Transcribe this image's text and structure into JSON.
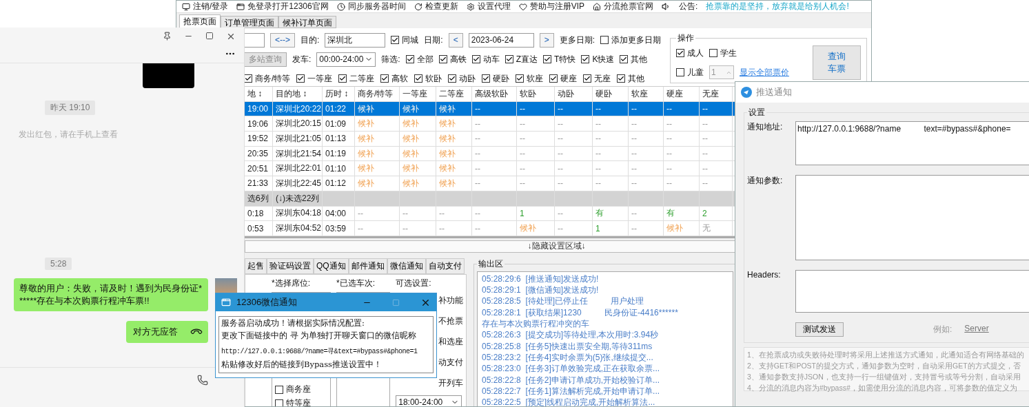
{
  "main_window": {
    "toolbar": [
      {
        "label": "注销/登录"
      },
      {
        "label": "免登录打开12306官网"
      },
      {
        "label": "同步服务器时间"
      },
      {
        "label": "检查更新"
      },
      {
        "label": "设置代理"
      },
      {
        "label": "赞助与注册VIP"
      },
      {
        "label": "分流抢票官网"
      }
    ],
    "announcement": {
      "label": "公告:",
      "text": "抢票靠的是坚持，放弃就是给别人机会!"
    },
    "tabs": [
      {
        "label": "抢票页面",
        "selected": true
      },
      {
        "label": "订单管理页面",
        "selected": false
      },
      {
        "label": "候补订单页面",
        "selected": false
      }
    ],
    "query": {
      "swap_button": "<-->",
      "to_label": "目的:",
      "to_value": "深圳北",
      "same_city": {
        "label": "同城",
        "checked": true
      },
      "date_label": "日期:",
      "prev_button": "<",
      "date_value": "2023-06-24",
      "next_button": ">",
      "more_dates_label": "更多日期:",
      "add_dates": {
        "label": "添加更多日期",
        "checked": false
      },
      "multi_station_button": "多站查询",
      "depart_label": "发车:",
      "depart_value": "00:00-24:00",
      "filter_label": "筛选:",
      "filters": [
        {
          "label": "全部",
          "checked": true
        },
        {
          "label": "高铁",
          "checked": true
        },
        {
          "label": "动车",
          "checked": true
        },
        {
          "label": "Z直达",
          "checked": true
        },
        {
          "label": "T特快",
          "checked": true
        },
        {
          "label": "K快速",
          "checked": true
        },
        {
          "label": "其他",
          "checked": true
        }
      ],
      "seat_filters": [
        {
          "label": "商务/特等",
          "checked": true
        },
        {
          "label": "一等座",
          "checked": true
        },
        {
          "label": "二等座",
          "checked": true
        },
        {
          "label": "高软",
          "checked": true
        },
        {
          "label": "软卧",
          "checked": true
        },
        {
          "label": "动卧",
          "checked": true
        },
        {
          "label": "硬卧",
          "checked": true
        },
        {
          "label": "软座",
          "checked": true
        },
        {
          "label": "硬座",
          "checked": true
        },
        {
          "label": "无座",
          "checked": true
        },
        {
          "label": "其他",
          "checked": true
        }
      ]
    },
    "operations": {
      "title": "操作",
      "adult": {
        "label": "成人",
        "checked": true
      },
      "student": {
        "label": "学生",
        "checked": false
      },
      "child": {
        "label": "儿童",
        "checked": false
      },
      "child_count": "1",
      "show_prices_link": "显示全部票价",
      "query_button": "查询车票"
    },
    "table": {
      "columns": [
        "地 ↕",
        "目的地 ↕",
        "历时 ↕",
        "商务/特等",
        "一等座",
        "二等座",
        "高级软卧",
        "软卧",
        "动卧",
        "硬卧",
        "软座",
        "硬座",
        "无座"
      ],
      "rows": [
        {
          "kind": "train",
          "selected": true,
          "cells": [
            "19:00",
            "深圳北20:22",
            "01:22",
            {
              "text": "候补",
              "kind": "waitlist"
            },
            {
              "text": "候补",
              "kind": "waitlist"
            },
            {
              "text": "候补",
              "kind": "waitlist"
            },
            "--",
            "--",
            "--",
            "--",
            "--",
            "--",
            "--"
          ]
        },
        {
          "kind": "train",
          "selected": false,
          "cells": [
            "19:06",
            "深圳北20:15",
            "01:09",
            {
              "text": "候补",
              "kind": "waitlist"
            },
            {
              "text": "候补",
              "kind": "waitlist"
            },
            {
              "text": "候补",
              "kind": "waitlist"
            },
            "--",
            "--",
            "--",
            "--",
            "--",
            "--",
            "--"
          ]
        },
        {
          "kind": "train",
          "selected": false,
          "cells": [
            "19:52",
            "深圳北21:05",
            "01:13",
            {
              "text": "候补",
              "kind": "waitlist"
            },
            {
              "text": "候补",
              "kind": "waitlist"
            },
            {
              "text": "候补",
              "kind": "waitlist"
            },
            "--",
            "--",
            "--",
            "--",
            "--",
            "--",
            "--"
          ]
        },
        {
          "kind": "train",
          "selected": false,
          "cells": [
            "20:35",
            "深圳北21:54",
            "01:19",
            {
              "text": "候补",
              "kind": "waitlist"
            },
            {
              "text": "候补",
              "kind": "waitlist"
            },
            {
              "text": "候补",
              "kind": "waitlist"
            },
            "--",
            "--",
            "--",
            "--",
            "--",
            "--",
            "--"
          ]
        },
        {
          "kind": "train",
          "selected": false,
          "cells": [
            "20:51",
            "深圳北22:01",
            "01:10",
            {
              "text": "候补",
              "kind": "waitlist"
            },
            {
              "text": "候补",
              "kind": "waitlist"
            },
            {
              "text": "候补",
              "kind": "waitlist"
            },
            "--",
            "--",
            "--",
            "--",
            "--",
            "--",
            "--"
          ]
        },
        {
          "kind": "train",
          "selected": false,
          "cells": [
            "21:33",
            "深圳北22:45",
            "01:12",
            {
              "text": "候补",
              "kind": "waitlist"
            },
            {
              "text": "候补",
              "kind": "waitlist"
            },
            {
              "text": "候补",
              "kind": "waitlist"
            },
            "--",
            "--",
            "--",
            "--",
            "--",
            "--",
            "--"
          ]
        },
        {
          "kind": "group",
          "selected": false,
          "cells": [
            "选6列",
            "(↓)未选22列"
          ]
        },
        {
          "kind": "train",
          "selected": false,
          "cells": [
            "0:18",
            "深圳东04:18",
            "04:00",
            "--",
            "--",
            "--",
            "--",
            {
              "text": "1",
              "kind": "available"
            },
            "--",
            {
              "text": "有",
              "kind": "available"
            },
            "--",
            {
              "text": "有",
              "kind": "available"
            },
            {
              "text": "2",
              "kind": "available"
            }
          ]
        },
        {
          "kind": "train",
          "selected": false,
          "cells": [
            "0:53",
            "深圳东04:52",
            "03:59",
            "--",
            "--",
            "--",
            "--",
            {
              "text": "候补",
              "kind": "waitlist"
            },
            "--",
            {
              "text": "1",
              "kind": "available"
            },
            "--",
            {
              "text": "候补",
              "kind": "waitlist"
            },
            "无"
          ]
        }
      ]
    },
    "hide_settings_bar": "↓隐藏设置区域↓",
    "settings_tabs": [
      {
        "label": "起售",
        "selected": false
      },
      {
        "label": "验证码设置",
        "selected": false
      },
      {
        "label": "QQ通知",
        "selected": false
      },
      {
        "label": "邮件通知",
        "selected": false
      },
      {
        "label": "微信通知",
        "selected": false
      },
      {
        "label": "自动支付",
        "selected": false
      }
    ],
    "settings": {
      "seat_label": "*选择席位:",
      "seats": [
        {
          "label": "商务座",
          "checked": false
        },
        {
          "label": "特等座",
          "checked": false
        }
      ],
      "trains_label": "*已选车次:",
      "options_label": "可选设置:",
      "options": [
        "补功能",
        "不抢票",
        "和选座",
        "动支付",
        "开列车"
      ],
      "time_range": "18:00-24:00"
    },
    "output": {
      "title": "输出区",
      "lines": [
        {
          "time": "05:28:29:6",
          "text": "[推送通知]发送成功!"
        },
        {
          "time": "05:28:29:1",
          "text": "[微信通知]发送成功!"
        },
        {
          "time": "05:28:28:5",
          "text": "[待处理]已停止任          用户处理"
        },
        {
          "time": "05:28:28:1",
          "text": "[获取结果]1230          民身份证-4416******"
        },
        {
          "text": "存在与本次购票行程冲突的车"
        },
        {
          "time": "05:28:26:3",
          "text": "[提交成功]等待处理,本次用时:3.94秒"
        },
        {
          "time": "05:28:25:8",
          "text": "[任务5]快速出票安全期,等待311ms"
        },
        {
          "time": "05:28:23:2",
          "text": "[任务4]实时余票为(5)张,继续提交..."
        },
        {
          "time": "05:28:23:0",
          "text": "[任务3]订单效验完成,正在获取余票..."
        },
        {
          "time": "05:28:22:8",
          "text": "[任务2]申请订单成功,开始校验订单..."
        },
        {
          "time": "05:28:22:7",
          "text": "[任务1]算法解析完成,开始申请订单..."
        },
        {
          "time": "05:28:22:5",
          "text": "[预定]线程启动完成,开始解析算法..."
        }
      ]
    }
  },
  "chat_window": {
    "messages": [
      {
        "kind": "image"
      },
      {
        "kind": "time",
        "text": "昨天 19:10"
      },
      {
        "kind": "system",
        "text": "发出红包，请在手机上查看"
      },
      {
        "kind": "time",
        "text": "5:28"
      },
      {
        "kind": "bubble",
        "text": "尊敬的用户：失败，请及时！遇到为民身份证******存在与本次购票行程冲车票!!"
      },
      {
        "kind": "call",
        "text": "对方无应答"
      }
    ]
  },
  "wechat_popup": {
    "title": "12306微信通知",
    "lines": [
      "服务器启动成功！请根据实际情况配置:",
      "更改下面链接中的 寻 为单独打开聊天窗口的微信昵称",
      "http://127.0.0.1:9688/?name=寻&text=#bypass#&phone=1",
      "粘贴修改好后的链接到Bypass推送设置中！"
    ]
  },
  "push_window": {
    "title": "推送通知",
    "group": "设置",
    "url_label": "通知地址:",
    "url_value": "http://127.0.0.1:9688/?name          text=#bypass#&phone=",
    "params_label": "通知参数:",
    "headers_label": "Headers:",
    "test_button": "测试发送",
    "example_label": "例如:",
    "example_link": "Server",
    "notes": [
      "1、在抢票成功或失败待处理时将采用上述推送方式通知，此通知适合有网络基础的",
      "2、支持GET和POST的提交方式，通知参数为空时，自动采用GET的方式提交，否",
      "3、通知参数支持JSON，也支持一行一组键值对，支持冒号或等号分割，自动采用",
      "4、分流的消息内容为#bypass#，如需使用分流的消息内容，可将参数的值定义为"
    ]
  }
}
